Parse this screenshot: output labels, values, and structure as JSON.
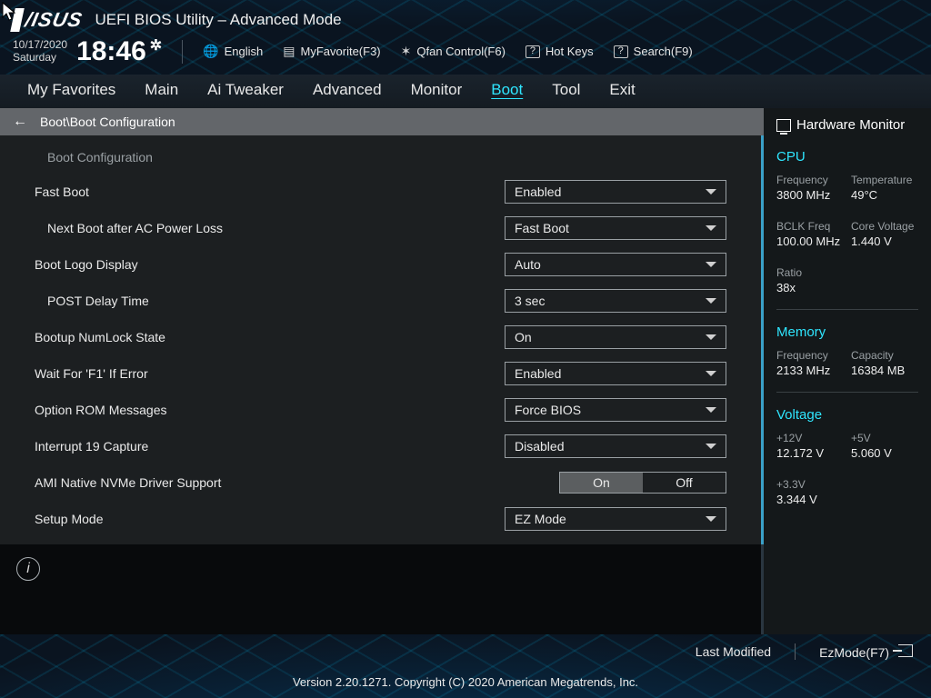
{
  "brand": "ASUS",
  "app_title": "UEFI BIOS Utility – Advanced Mode",
  "date": {
    "line1": "10/17/2020",
    "line2": "Saturday"
  },
  "clock": "18:46",
  "header_buttons": {
    "language": "English",
    "favorite": "MyFavorite(F3)",
    "qfan": "Qfan Control(F6)",
    "hotkeys": "Hot Keys",
    "search": "Search(F9)"
  },
  "tabs": [
    "My Favorites",
    "Main",
    "Ai Tweaker",
    "Advanced",
    "Monitor",
    "Boot",
    "Tool",
    "Exit"
  ],
  "tabs_active": "Boot",
  "breadcrumb": "Boot\\Boot Configuration",
  "group_title": "Boot Configuration",
  "rows": [
    {
      "label": "Fast Boot",
      "type": "select",
      "value": "Enabled"
    },
    {
      "label": "Next Boot after AC Power Loss",
      "type": "select",
      "value": "Fast Boot",
      "indent": true
    },
    {
      "label": "Boot Logo Display",
      "type": "select",
      "value": "Auto"
    },
    {
      "label": "POST Delay Time",
      "type": "select",
      "value": "3 sec",
      "indent": true
    },
    {
      "label": "Bootup NumLock State",
      "type": "select",
      "value": "On"
    },
    {
      "label": "Wait For 'F1' If Error",
      "type": "select",
      "value": "Enabled"
    },
    {
      "label": "Option ROM Messages",
      "type": "select",
      "value": "Force BIOS"
    },
    {
      "label": "Interrupt 19 Capture",
      "type": "select",
      "value": "Disabled"
    },
    {
      "label": "AMI Native NVMe Driver Support",
      "type": "toggle",
      "value": "On",
      "alt": "Off"
    },
    {
      "label": "Setup Mode",
      "type": "select",
      "value": "EZ Mode"
    }
  ],
  "sidebar": {
    "title": "Hardware Monitor",
    "cpu": {
      "heading": "CPU",
      "freq_k": "Frequency",
      "freq_v": "3800 MHz",
      "temp_k": "Temperature",
      "temp_v": "49°C",
      "bclk_k": "BCLK Freq",
      "bclk_v": "100.00 MHz",
      "vcore_k": "Core Voltage",
      "vcore_v": "1.440 V",
      "ratio_k": "Ratio",
      "ratio_v": "38x"
    },
    "memory": {
      "heading": "Memory",
      "freq_k": "Frequency",
      "freq_v": "2133 MHz",
      "cap_k": "Capacity",
      "cap_v": "16384 MB"
    },
    "voltage": {
      "heading": "Voltage",
      "v12_k": "+12V",
      "v12_v": "12.172 V",
      "v5_k": "+5V",
      "v5_v": "5.060 V",
      "v33_k": "+3.3V",
      "v33_v": "3.344 V"
    }
  },
  "footer": {
    "last_modified": "Last Modified",
    "ezmode": "EzMode(F7)"
  },
  "copyright": "Version 2.20.1271. Copyright (C) 2020 American Megatrends, Inc."
}
